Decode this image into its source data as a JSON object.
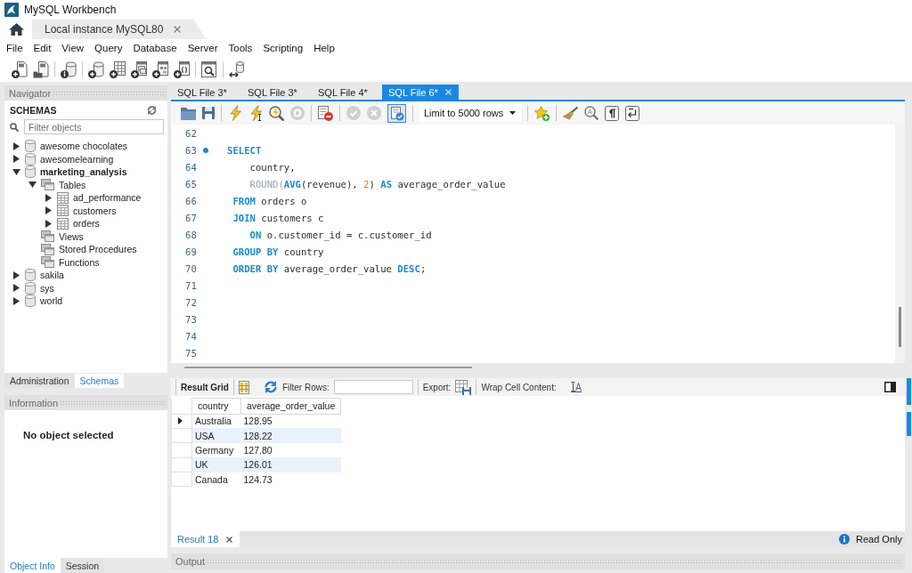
{
  "window": {
    "title": "MySQL Workbench"
  },
  "connection_tabs": [
    {
      "label": "Local instance MySQL80",
      "selected": true
    }
  ],
  "menu": [
    "File",
    "Edit",
    "View",
    "Query",
    "Database",
    "Server",
    "Tools",
    "Scripting",
    "Help"
  ],
  "navigator": {
    "title": "Navigator",
    "heading": "SCHEMAS",
    "filter": {
      "placeholder": "Filter objects"
    },
    "tree": [
      {
        "kind": "schema",
        "label": "awesome chocolates",
        "default": false,
        "expanded": false
      },
      {
        "kind": "schema",
        "label": "awesomelearning",
        "default": false,
        "expanded": false
      },
      {
        "kind": "schema",
        "label": "marketing_analysis",
        "default": true,
        "expanded": true,
        "children": [
          {
            "kind": "folder",
            "label": "Tables",
            "expanded": true,
            "children": [
              {
                "kind": "table",
                "label": "ad_performance",
                "expanded": false
              },
              {
                "kind": "table",
                "label": "customers",
                "expanded": false
              },
              {
                "kind": "table",
                "label": "orders",
                "expanded": false
              }
            ]
          },
          {
            "kind": "folder",
            "label": "Views"
          },
          {
            "kind": "folder",
            "label": "Stored Procedures"
          },
          {
            "kind": "folder",
            "label": "Functions"
          }
        ]
      },
      {
        "kind": "schema",
        "label": "sakila",
        "default": false,
        "expanded": false
      },
      {
        "kind": "schema",
        "label": "sys",
        "default": false,
        "expanded": false
      },
      {
        "kind": "schema",
        "label": "world",
        "default": false,
        "expanded": false
      }
    ]
  },
  "sidebar_tabs": [
    {
      "label": "Administration",
      "selected": false
    },
    {
      "label": "Schemas",
      "selected": true
    }
  ],
  "information": {
    "title": "Information",
    "message": "No object selected"
  },
  "info_tabs": [
    {
      "label": "Object Info",
      "selected": true
    },
    {
      "label": "Session",
      "selected": false
    }
  ],
  "editor_tabs": [
    {
      "label": "SQL File 3*",
      "selected": false
    },
    {
      "label": "SQL File 3*",
      "selected": false
    },
    {
      "label": "SQL File 4*",
      "selected": false
    },
    {
      "label": "SQL File 6*",
      "selected": true
    }
  ],
  "editor_toolbar": {
    "stop": {
      "disabled": true
    },
    "commit": {
      "disabled": true
    },
    "rollback": {
      "disabled": true
    },
    "autocommit": {
      "on": true
    },
    "row_limit": "Limit to 5000 rows"
  },
  "code": {
    "lines": [
      {
        "number": "62",
        "marker": false
      },
      {
        "number": "63",
        "marker": true,
        "tokens": [
          {
            "kind": "keyword",
            "text": "SELECT"
          }
        ]
      },
      {
        "number": "64",
        "marker": false,
        "tokens": [
          {
            "kind": "plain",
            "text": "    country,"
          }
        ]
      },
      {
        "number": "65",
        "marker": false,
        "tokens": [
          {
            "kind": "function",
            "text": "    ROUND("
          },
          {
            "kind": "keyword",
            "text": "AVG"
          },
          {
            "kind": "plain",
            "text": "(revenue), "
          },
          {
            "kind": "number",
            "text": "2"
          },
          {
            "kind": "plain",
            "text": ") "
          },
          {
            "kind": "keyword",
            "text": "AS"
          },
          {
            "kind": "plain",
            "text": " average_order_value"
          }
        ]
      },
      {
        "number": "66",
        "marker": false,
        "tokens": [
          {
            "kind": "keyword",
            "text": " FROM"
          },
          {
            "kind": "plain",
            "text": " orders o"
          }
        ]
      },
      {
        "number": "67",
        "marker": false,
        "tokens": [
          {
            "kind": "keyword",
            "text": " JOIN"
          },
          {
            "kind": "plain",
            "text": " customers c"
          }
        ]
      },
      {
        "number": "68",
        "marker": false,
        "tokens": [
          {
            "kind": "keyword",
            "text": "    ON"
          },
          {
            "kind": "plain",
            "text": " o.customer_id = c.customer_id"
          }
        ]
      },
      {
        "number": "69",
        "marker": false,
        "tokens": [
          {
            "kind": "keyword",
            "text": " GROUP BY"
          },
          {
            "kind": "plain",
            "text": " country"
          }
        ]
      },
      {
        "number": "70",
        "marker": false,
        "tokens": [
          {
            "kind": "keyword",
            "text": " ORDER BY"
          },
          {
            "kind": "plain",
            "text": " average_order_value "
          },
          {
            "kind": "keyword",
            "text": "DESC"
          },
          {
            "kind": "plain",
            "text": ";"
          }
        ]
      },
      {
        "number": "71",
        "marker": false
      },
      {
        "number": "72",
        "marker": false
      },
      {
        "number": "73",
        "marker": false
      },
      {
        "number": "74",
        "marker": false
      },
      {
        "number": "75",
        "marker": false
      }
    ]
  },
  "result": {
    "mode": "Result Grid",
    "filter_label": "Filter Rows:",
    "export_label": "Export:",
    "wrap_label": "Wrap Cell Content:",
    "columns": [
      "country",
      "average_order_value"
    ],
    "rows": [
      {
        "cells": [
          "Australia",
          "128.95"
        ],
        "current": true
      },
      {
        "cells": [
          "USA",
          "128.22"
        ],
        "current": false
      },
      {
        "cells": [
          "Germany",
          "127.80"
        ],
        "current": false
      },
      {
        "cells": [
          "UK",
          "126.01"
        ],
        "current": false
      },
      {
        "cells": [
          "Canada",
          "124.73"
        ],
        "current": false
      }
    ],
    "tabs": [
      {
        "label": "Result 18",
        "selected": true
      }
    ],
    "status": "Read Only"
  },
  "output": {
    "title": "Output"
  }
}
